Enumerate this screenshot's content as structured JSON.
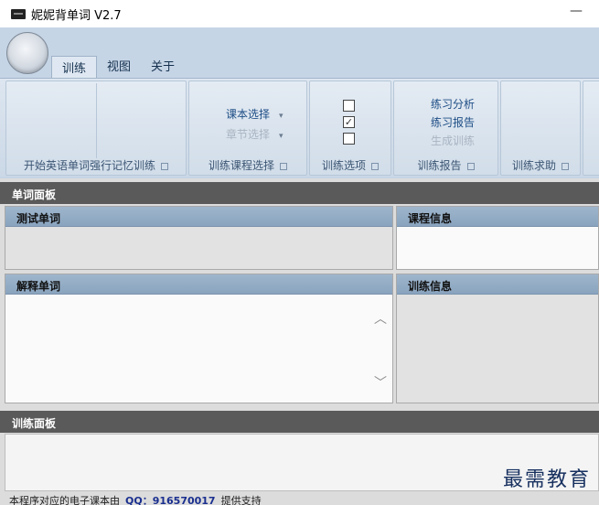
{
  "window": {
    "title": "妮妮背单词 V2.7",
    "minimize_glyph": "—"
  },
  "ribbon": {
    "tabs": [
      {
        "label": "训练",
        "active": true
      },
      {
        "label": "视图",
        "active": false
      },
      {
        "label": "关于",
        "active": false
      }
    ],
    "groups": {
      "train": {
        "label": "开始英语单词强行记忆训练"
      },
      "course": {
        "label": "训练课程选择",
        "items": [
          {
            "label": "课本选择",
            "enabled": true
          },
          {
            "label": "章节选择",
            "enabled": false
          }
        ],
        "dropdown_glyph": "▾"
      },
      "options": {
        "label": "训练选项",
        "checkboxes": [
          false,
          true,
          false
        ],
        "check_glyph": "✓"
      },
      "report": {
        "label": "训练报告",
        "items": [
          {
            "label": "练习分析",
            "enabled": true
          },
          {
            "label": "练习报告",
            "enabled": true
          },
          {
            "label": "生成训练",
            "enabled": false
          }
        ]
      },
      "help": {
        "label": "训练求助"
      }
    }
  },
  "panels": {
    "word_panel": {
      "title": "单词面板"
    },
    "test_word": {
      "title": "测试单词"
    },
    "course_info": {
      "title": "课程信息"
    },
    "explain_word": {
      "title": "解释单词"
    },
    "train_info": {
      "title": "训练信息"
    },
    "train_panel": {
      "title": "训练面板"
    },
    "scroll_up_glyph": "︿",
    "scroll_down_glyph": "﹀"
  },
  "watermark": "最需教育",
  "statusbar": {
    "prefix": "本程序对应的电子课本由",
    "qq": "QQ：916570017",
    "suffix": "提供支持"
  }
}
